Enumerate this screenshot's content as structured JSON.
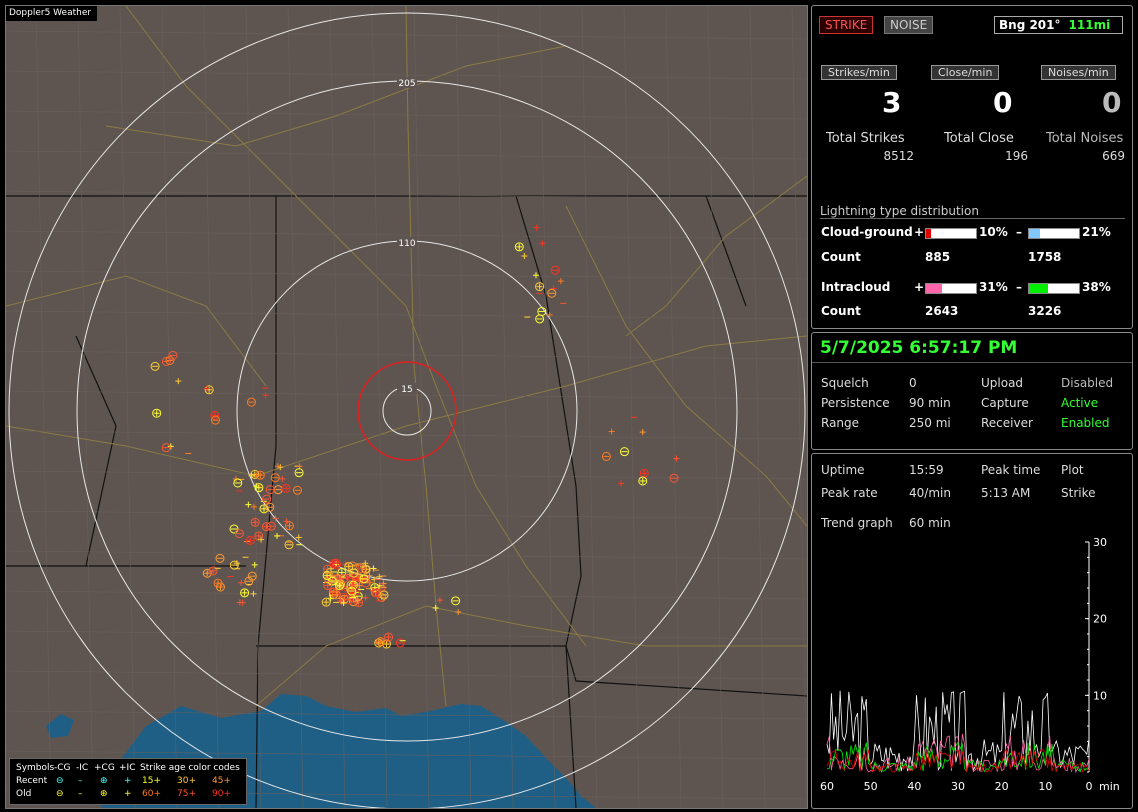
{
  "map": {
    "title": "Doppler5 Weather",
    "ring_labels": [
      "205",
      "110",
      "15"
    ],
    "legend": {
      "header": [
        "Symbols",
        "-CG",
        "-IC",
        "+CG",
        "+IC",
        "Strike age color codes"
      ],
      "recent_label": "Recent",
      "old_label": "Old",
      "age_recent": [
        "15+",
        "30+",
        "45+"
      ],
      "age_old": [
        "60+",
        "75+",
        "90+"
      ],
      "colors": [
        "#ffff33",
        "#ffcc33",
        "#ff9933",
        "#ff7a22",
        "#ff5533",
        "#ff3322"
      ]
    }
  },
  "status": {
    "strike_button": "STRIKE",
    "noise_button": "NOISE",
    "bearing_label": "Bng 201°",
    "bearing_distance": "111mi",
    "rates": [
      {
        "label": "Strikes/min",
        "value": "3"
      },
      {
        "label": "Close/min",
        "value": "0"
      },
      {
        "label": "Noises/min",
        "value": "0"
      }
    ],
    "totals": [
      {
        "label": "Total Strikes",
        "value": "8512"
      },
      {
        "label": "Total Close",
        "value": "196"
      },
      {
        "label": "Total Noises",
        "value": "669"
      }
    ],
    "distribution_title": "Lightning type distribution",
    "cloud_ground": {
      "label": "Cloud-ground",
      "plus_sign": "+",
      "plus_pct": "10%",
      "plus_frac": 0.1,
      "plus_color": "#e00000",
      "minus_sign": "–",
      "minus_pct": "21%",
      "minus_frac": 0.21,
      "minus_color": "#80c8ff",
      "count_label": "Count",
      "plus_count": "885",
      "minus_count": "1758"
    },
    "intracloud": {
      "label": "Intracloud",
      "plus_sign": "+",
      "plus_pct": "31%",
      "plus_frac": 0.31,
      "plus_color": "#ff66aa",
      "minus_sign": "–",
      "minus_pct": "38%",
      "minus_frac": 0.38,
      "minus_color": "#00ee00",
      "count_label": "Count",
      "plus_count": "2643",
      "minus_count": "3226"
    }
  },
  "settings": {
    "datetime": "5/7/2025 6:57:17 PM",
    "rows": [
      {
        "k1": "Squelch",
        "v1": "0",
        "k2": "Upload",
        "v2": "Disabled"
      },
      {
        "k1": "Persistence",
        "v1": "90 min",
        "k2": "Capture",
        "v2": "Active"
      },
      {
        "k1": "Range",
        "v1": "250 mi",
        "k2": "Receiver",
        "v2": "Enabled"
      }
    ]
  },
  "stats": {
    "uptime_label": "Uptime",
    "uptime_value": "15:59",
    "peak_time_label": "Peak time",
    "plot_label": "Plot",
    "peak_rate_label": "Peak rate",
    "peak_rate_value": "40/min",
    "peak_time_value": "5:13 AM",
    "plot_value": "Strike",
    "trend_label": "Trend graph",
    "trend_value": "60 min"
  },
  "chart_data": {
    "type": "line",
    "x": [
      60,
      50,
      40,
      30,
      20,
      10,
      0
    ],
    "x_tick_labels": [
      "60",
      "50",
      "40",
      "30",
      "20",
      "10",
      "0"
    ],
    "x_unit": "min",
    "y_tick_labels": [
      "10",
      "20",
      "30"
    ],
    "ylim": [
      0,
      30
    ],
    "series_colors": [
      "#ffffff",
      "#ff66aa",
      "#00ee00",
      "#e00000"
    ]
  }
}
